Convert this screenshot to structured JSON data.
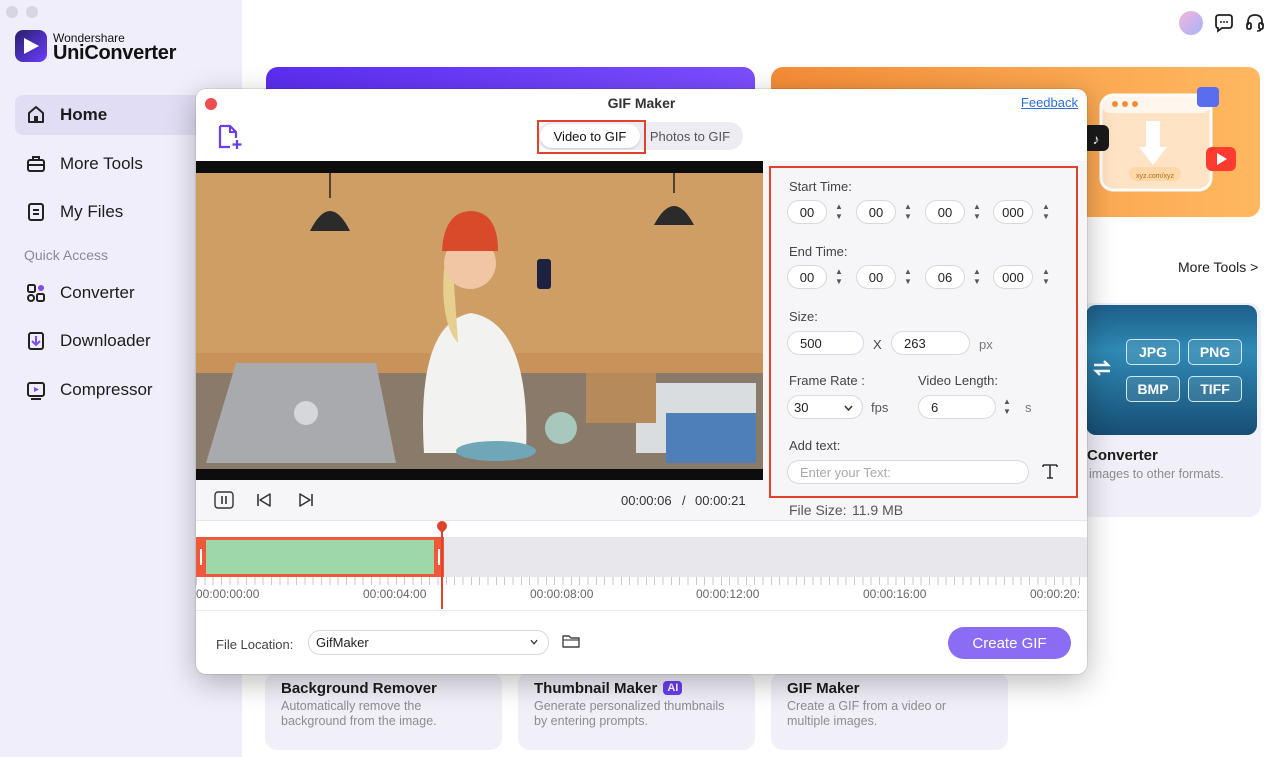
{
  "app": {
    "brand_small": "Wondershare",
    "brand_big": "UniConverter"
  },
  "sidebar": {
    "items": [
      {
        "label": "Home",
        "icon": "home-icon",
        "active": true
      },
      {
        "label": "More Tools",
        "icon": "toolbox-icon"
      },
      {
        "label": "My Files",
        "icon": "file-icon"
      }
    ],
    "quick_access_label": "Quick Access",
    "quick_items": [
      {
        "label": "Converter",
        "icon": "converter-icon"
      },
      {
        "label": "Downloader",
        "icon": "downloader-icon"
      },
      {
        "label": "Compressor",
        "icon": "compressor-icon"
      }
    ]
  },
  "header_icons": [
    "avatar",
    "chat-icon",
    "support-icon"
  ],
  "main": {
    "more_tools_link": "More Tools >",
    "converter_card": {
      "title": "Converter",
      "desc": "images to other formats.",
      "formats": [
        "JPG",
        "PNG",
        "BMP",
        "TIFF"
      ]
    },
    "banner_orange_text": "xyz.com/xyz",
    "bottom_cards": [
      {
        "title": "Background Remover",
        "desc": "Automatically remove the background from the image."
      },
      {
        "title": "Thumbnail Maker",
        "badge": "AI",
        "desc": "Generate personalized thumbnails by entering prompts."
      },
      {
        "title": "GIF Maker",
        "desc": "Create a GIF from a video or multiple images."
      }
    ]
  },
  "modal": {
    "title": "GIF Maker",
    "feedback": "Feedback",
    "tabs": [
      "Video to GIF",
      "Photos to GIF"
    ],
    "active_tab": "Video to GIF",
    "player": {
      "current_time": "00:00:06",
      "separator": "/",
      "total_time": "00:00:21"
    },
    "settings": {
      "start_label": "Start Time:",
      "start": [
        "00",
        "00",
        "00",
        "000"
      ],
      "end_label": "End Time:",
      "end": [
        "00",
        "00",
        "06",
        "000"
      ],
      "size_label": "Size:",
      "width": "500",
      "x_sep": "X",
      "height": "263",
      "size_unit": "px",
      "frame_rate_label": "Frame Rate :",
      "frame_rate": "30",
      "fps_unit": "fps",
      "video_length_label": "Video Length:",
      "video_length": "6",
      "length_unit": "s",
      "add_text_label": "Add text:",
      "text_placeholder": "Enter your Text:",
      "file_size_label": "File Size:",
      "file_size": "11.9 MB"
    },
    "timeline": {
      "labels": [
        "00:00:00:00",
        "00:00:04:00",
        "00:00:08:00",
        "00:00:12:00",
        "00:00:16:00",
        "00:00:20:"
      ],
      "selection_start_s": 0,
      "selection_end_s": 6,
      "playhead_s": 6
    },
    "footer": {
      "file_location_label": "File Location:",
      "file_location": "GifMaker",
      "create_button": "Create GIF"
    }
  },
  "colors": {
    "accent": "#8b6cf5",
    "highlight": "#e0432c",
    "sidebar_bg": "#efeefa",
    "selection": "#9fd8a8"
  }
}
